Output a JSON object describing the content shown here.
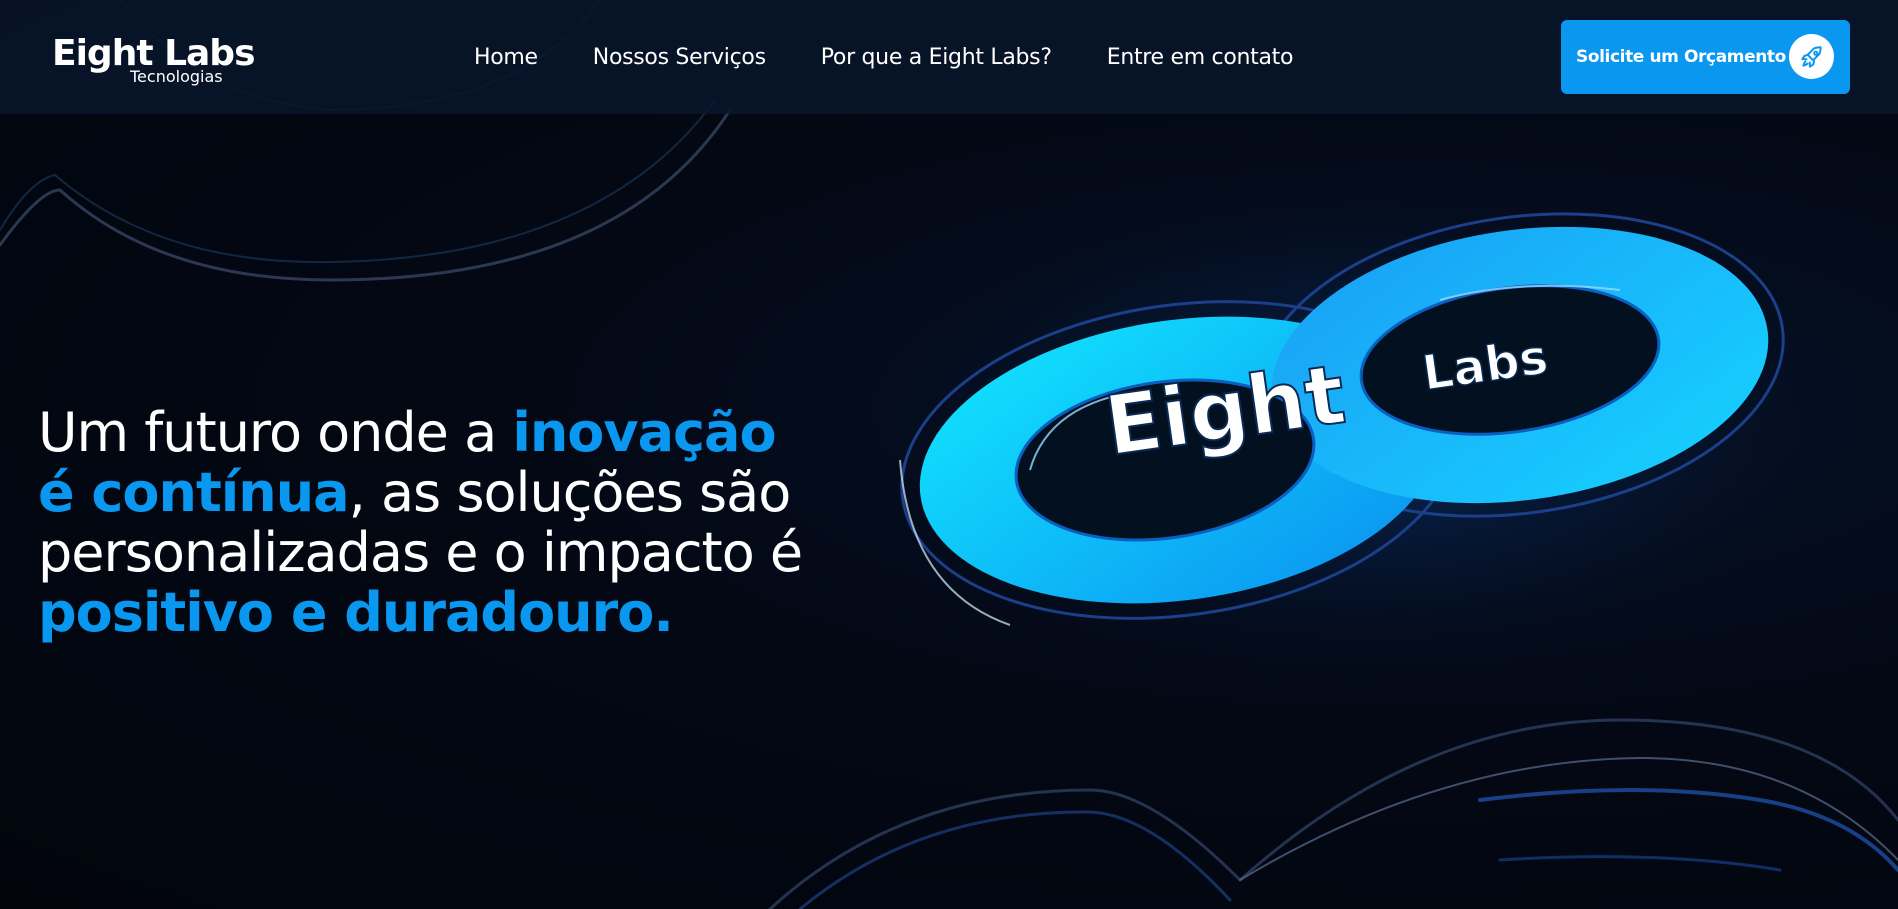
{
  "header": {
    "logo_main": "Eight Labs",
    "logo_sub": "Tecnologias",
    "nav": [
      {
        "label": "Home"
      },
      {
        "label": "Nossos Serviços"
      },
      {
        "label": "Por que a Eight Labs?"
      },
      {
        "label": "Entre em contato"
      }
    ],
    "cta_label": "Solicite um Orçamento",
    "cta_icon": "rocket-icon"
  },
  "hero": {
    "title_parts": {
      "p1": "Um futuro onde a ",
      "p2": "inovação",
      "p3": "é contínua",
      "p4": ", as soluções são personalizadas e o impacto é ",
      "p5": "positivo e duradouro."
    },
    "graphic_text_main": "Eight",
    "graphic_text_sub": "Labs"
  },
  "colors": {
    "accent": "#0a97f0",
    "header_bg": "#08162c",
    "page_bg": "#02050c",
    "graphic_cyan": "#00e0ff",
    "graphic_blue": "#0a9cf5"
  }
}
